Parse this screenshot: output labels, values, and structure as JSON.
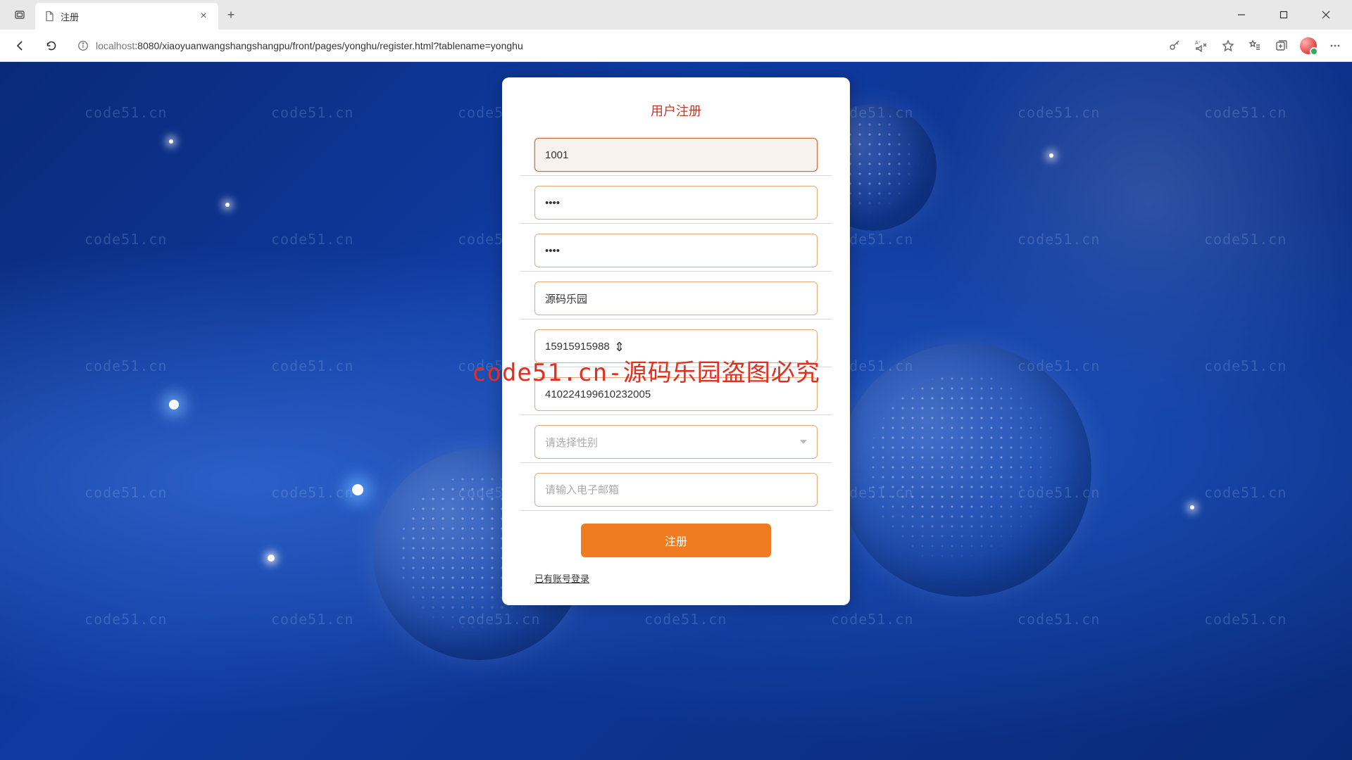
{
  "browser": {
    "tab_title": "注册",
    "url_host": "localhost",
    "url_port_path": ":8080/xiaoyuanwangshangshangpu/front/pages/yonghu/register.html?tablename=yonghu"
  },
  "page": {
    "card_title": "用户注册",
    "fields": {
      "username": {
        "value": "1001"
      },
      "password": {
        "value": "••••"
      },
      "password_confirm": {
        "value": "••••"
      },
      "nickname": {
        "value": "源码乐园"
      },
      "phone": {
        "value": "15915915988"
      },
      "id_number": {
        "value": "410224199610232005"
      },
      "gender": {
        "placeholder": "请选择性别"
      },
      "email": {
        "placeholder": "请输入电子邮箱"
      }
    },
    "submit_label": "注册",
    "login_link": "已有账号登录"
  },
  "watermark": {
    "tile": "code51.cn",
    "red_overlay": "code51.cn-源码乐园盗图必究"
  }
}
